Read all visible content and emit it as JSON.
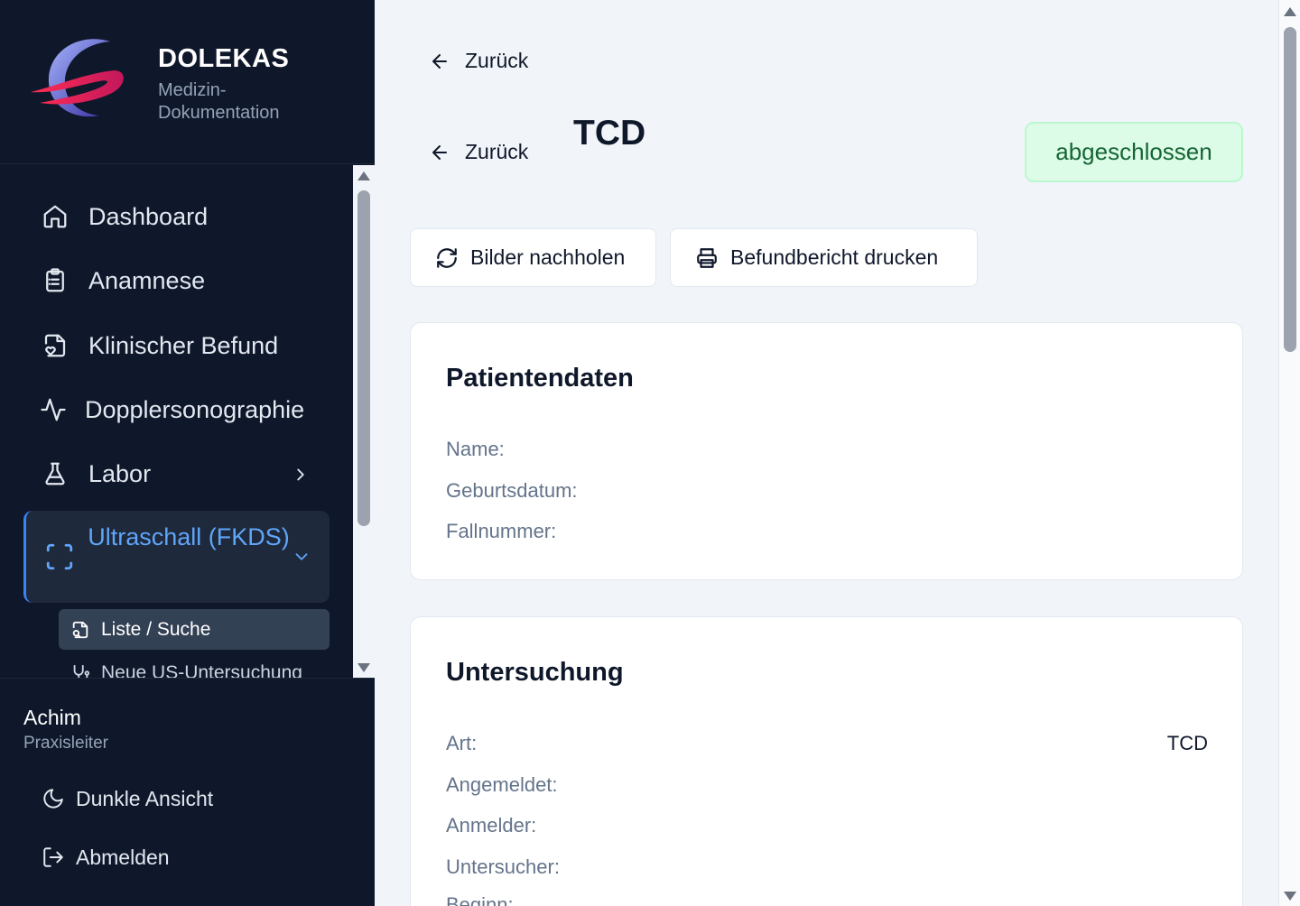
{
  "brand": {
    "name": "DOLEKAS",
    "subtitle": "Medizin-Dokumentation"
  },
  "sidebar": {
    "items": [
      {
        "label": "Dashboard",
        "icon": "home-icon"
      },
      {
        "label": "Anamnese",
        "icon": "clipboard-list-icon"
      },
      {
        "label": "Klinischer Befund",
        "icon": "file-heart-icon"
      },
      {
        "label": "Dopplersonographie",
        "icon": "activity-icon"
      },
      {
        "label": "Labor",
        "icon": "flask-icon"
      }
    ],
    "active": {
      "label": "Ultraschall (FKDS)",
      "icon": "scan-icon"
    },
    "sub_items": [
      {
        "label": "Liste / Suche",
        "icon": "file-search-icon"
      },
      {
        "label": "Neue US-Untersuchung",
        "icon": "stethoscope-icon"
      }
    ]
  },
  "user": {
    "name": "Achim",
    "role": "Praxisleiter",
    "dark_mode_label": "Dunkle Ansicht",
    "logout_label": "Abmelden"
  },
  "main": {
    "back_label_top": "Zurück",
    "back_label": "Zurück",
    "title": "TCD",
    "status": "abgeschlossen",
    "actions": {
      "reload_images": "Bilder nachholen",
      "print_report": "Befundbericht drucken"
    },
    "patient": {
      "heading": "Patientendaten",
      "name_label": "Name:",
      "birth_label": "Geburtsdatum:",
      "case_label": "Fallnummer:"
    },
    "exam": {
      "heading": "Untersuchung",
      "type_label": "Art:",
      "type_value": "TCD",
      "registered_label": "Angemeldet:",
      "referrer_label": "Anmelder:",
      "examiner_label": "Untersucher:",
      "start_label": "Beginn:"
    }
  },
  "colors": {
    "sidebar_bg": "#0f172a",
    "accent": "#60a5fa",
    "status_bg": "#dcfce7",
    "status_text": "#166534"
  }
}
